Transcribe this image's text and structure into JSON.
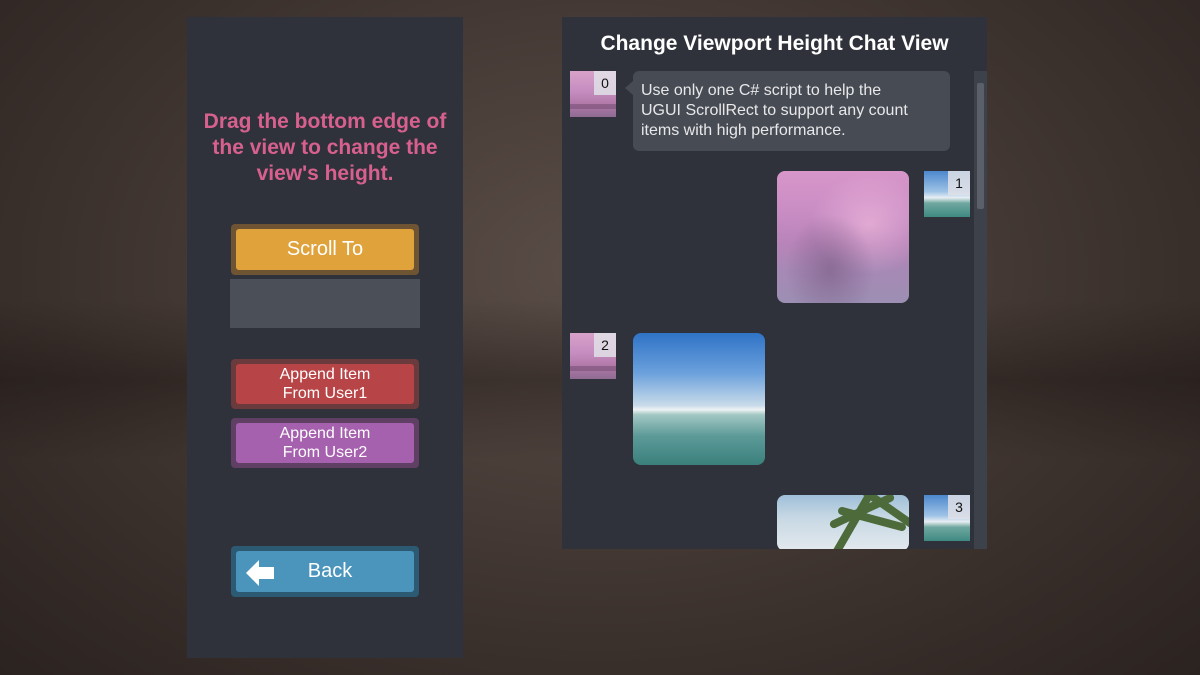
{
  "left_panel": {
    "instructions": [
      "Drag the bottom edge of",
      "the view to change the",
      "view's height."
    ],
    "scroll_to_label": "Scroll To",
    "scroll_input_value": "",
    "append_user1_lines": [
      "Append Item",
      "From User1"
    ],
    "append_user2_lines": [
      "Append Item",
      "From User2"
    ],
    "back_label": "Back"
  },
  "chat": {
    "title": "Change Viewport Height Chat View",
    "items": [
      {
        "index": "0",
        "side": "left",
        "avatar": "pink-sky",
        "type": "text",
        "text_lines": [
          "Use only one C# script to help the",
          "UGUI ScrollRect to support any count",
          "items with high performance."
        ]
      },
      {
        "index": "1",
        "side": "right",
        "avatar": "sea",
        "type": "image",
        "image": "pink-sky-photo"
      },
      {
        "index": "2",
        "side": "left",
        "avatar": "pink-sky",
        "type": "image",
        "image": "sea-lake-photo"
      },
      {
        "index": "3",
        "side": "right",
        "avatar": "sea",
        "type": "image",
        "image": "palm-tree-photo"
      }
    ]
  },
  "colors": {
    "panel_bg": "#2f323a",
    "instruction_text": "#d8608e",
    "scroll_button": "#e0a23a",
    "user1_button": "#b74446",
    "user2_button": "#a560ae",
    "back_button": "#4b95bd",
    "bubble_bg": "#474b54"
  },
  "icons": {
    "back": "left-arrow-icon"
  }
}
